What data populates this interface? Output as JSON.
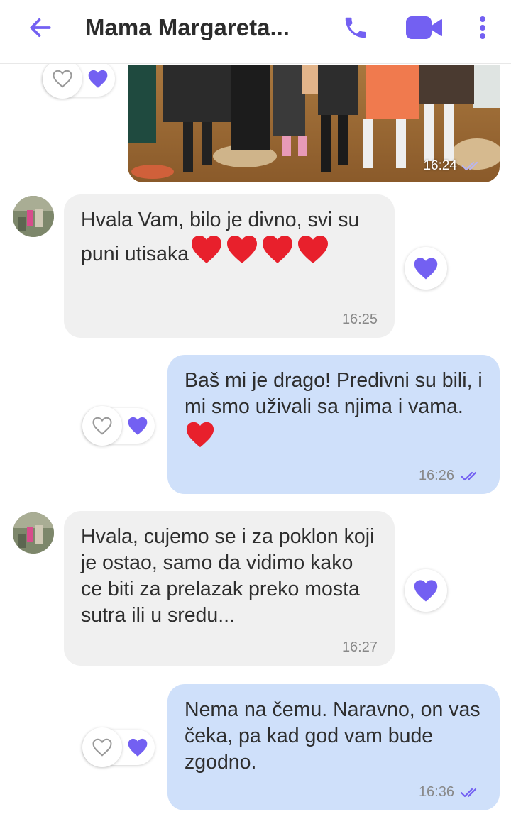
{
  "header": {
    "title": "Mama Margareta...",
    "accent": "#7360f2"
  },
  "messages": [
    {
      "id": "photo",
      "type": "image",
      "time": "16:24",
      "direction": "outgoing"
    },
    {
      "id": "m1",
      "direction": "incoming",
      "text": "Hvala Vam, bilo je divno, svi su puni utisaka",
      "time": "16:25"
    },
    {
      "id": "m2",
      "direction": "outgoing",
      "text": "Baš mi je drago! Predivni su bili, i mi smo uživali sa njima i vama.",
      "time": "16:26"
    },
    {
      "id": "m3",
      "direction": "incoming",
      "text": "Hvala, cujemo se i za poklon koji je ostao, samo da vidimo kako ce biti za prelazak preko mosta sutra ili u sredu...",
      "time": "16:27"
    },
    {
      "id": "m4",
      "direction": "outgoing",
      "text": "Nema na čemu. Naravno, on vas čeka, pa kad god vam bude zgodno.",
      "time": "16:36"
    }
  ],
  "colors": {
    "incoming_bubble": "#f0f0f0",
    "outgoing_bubble": "#cfe0fa",
    "heart_red": "#e8202c",
    "heart_purple": "#7360f2"
  }
}
